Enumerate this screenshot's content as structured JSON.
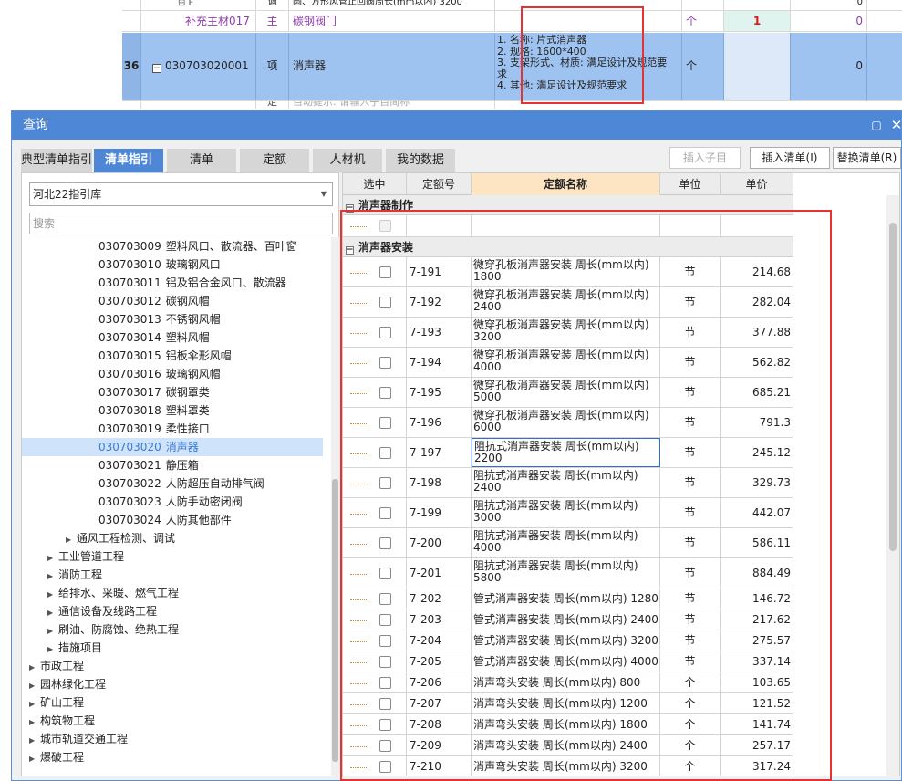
{
  "background": {
    "row_top": {
      "lines": [
        "圆、方形风管止回阀周长(mm以内) 3200"
      ],
      "kind": "调",
      "qty": "0"
    },
    "row_sub": {
      "name": "补充主材017",
      "kind": "主",
      "item": "碳钢阀门",
      "unit": "个",
      "qty": "1",
      "value": "0"
    },
    "row36": {
      "num": "36",
      "code": "030703020001",
      "kind": "项",
      "item": "消声器",
      "desc": [
        "1. 名称: 片式消声器",
        "2. 规格: 1600*400",
        "3. 支架形式、材质: 满足设计及规范要",
        "求",
        "4. 其他: 满足设计及规范要求"
      ],
      "unit": "个",
      "value": "0"
    },
    "row_next": {
      "kind": "定",
      "hint": "自动提示: 请输入子目简称"
    }
  },
  "dialog": {
    "title": "查询",
    "tabs": [
      "典型清单指引",
      "清单指引",
      "清单",
      "定额",
      "人材机",
      "我的数据"
    ],
    "buttons": {
      "insert_sub": "插入子目",
      "insert_list": "插入清单(I)",
      "replace_list": "替换清单(R)"
    },
    "library": "河北22指引库",
    "search_placeholder": "搜索",
    "tree": [
      {
        "code": "030703009",
        "label": "塑料风口、散流器、百叶窗"
      },
      {
        "code": "030703010",
        "label": "玻璃钢风口"
      },
      {
        "code": "030703011",
        "label": "铝及铝合金风口、散流器"
      },
      {
        "code": "030703012",
        "label": "碳钢风帽"
      },
      {
        "code": "030703013",
        "label": "不锈钢风帽"
      },
      {
        "code": "030703014",
        "label": "塑料风帽"
      },
      {
        "code": "030703015",
        "label": "铝板伞形风帽"
      },
      {
        "code": "030703016",
        "label": "玻璃钢风帽"
      },
      {
        "code": "030703017",
        "label": "碳钢罩类"
      },
      {
        "code": "030703018",
        "label": "塑料罩类"
      },
      {
        "code": "030703019",
        "label": "柔性接口"
      },
      {
        "code": "030703020",
        "label": "消声器"
      },
      {
        "code": "030703021",
        "label": "静压箱"
      },
      {
        "code": "030703022",
        "label": "人防超压自动排气阀"
      },
      {
        "code": "030703023",
        "label": "人防手动密闭阀"
      },
      {
        "code": "030703024",
        "label": "人防其他部件"
      }
    ],
    "tree_groups": [
      {
        "label": "通风工程检测、调试",
        "level": 3
      },
      {
        "label": "工业管道工程",
        "level": 2
      },
      {
        "label": "消防工程",
        "level": 2
      },
      {
        "label": "给排水、采暖、燃气工程",
        "level": 2
      },
      {
        "label": "通信设备及线路工程",
        "level": 2
      },
      {
        "label": "刷油、防腐蚀、绝热工程",
        "level": 2
      },
      {
        "label": "措施项目",
        "level": 2
      },
      {
        "label": "市政工程",
        "level": 1
      },
      {
        "label": "园林绿化工程",
        "level": 1
      },
      {
        "label": "矿山工程",
        "level": 1
      },
      {
        "label": "构筑物工程",
        "level": 1
      },
      {
        "label": "城市轨道交通工程",
        "level": 1
      },
      {
        "label": "爆破工程",
        "level": 1
      }
    ],
    "columns": [
      "选中",
      "定额号",
      "定额名称",
      "单位",
      "单价"
    ],
    "groups": [
      "消声器制作",
      "消声器安装"
    ],
    "rows": [
      {
        "code": "7-191",
        "name": [
          "微穿孔板消声器安装 周长(mm以内)",
          "1800"
        ],
        "unit": "节",
        "price": "214.68"
      },
      {
        "code": "7-192",
        "name": [
          "微穿孔板消声器安装 周长(mm以内)",
          "2400"
        ],
        "unit": "节",
        "price": "282.04"
      },
      {
        "code": "7-193",
        "name": [
          "微穿孔板消声器安装 周长(mm以内)",
          "3200"
        ],
        "unit": "节",
        "price": "377.88"
      },
      {
        "code": "7-194",
        "name": [
          "微穿孔板消声器安装 周长(mm以内)",
          "4000"
        ],
        "unit": "节",
        "price": "562.82"
      },
      {
        "code": "7-195",
        "name": [
          "微穿孔板消声器安装 周长(mm以内)",
          "5000"
        ],
        "unit": "节",
        "price": "685.21"
      },
      {
        "code": "7-196",
        "name": [
          "微穿孔板消声器安装 周长(mm以内)",
          "6000"
        ],
        "unit": "节",
        "price": "791.3"
      },
      {
        "code": "7-197",
        "name": [
          "阻抗式消声器安装 周长(mm以内)",
          "2200"
        ],
        "unit": "节",
        "price": "245.12"
      },
      {
        "code": "7-198",
        "name": [
          "阻抗式消声器安装 周长(mm以内)",
          "2400"
        ],
        "unit": "节",
        "price": "329.73"
      },
      {
        "code": "7-199",
        "name": [
          "阻抗式消声器安装 周长(mm以内)",
          "3000"
        ],
        "unit": "节",
        "price": "442.07"
      },
      {
        "code": "7-200",
        "name": [
          "阻抗式消声器安装 周长(mm以内)",
          "4000"
        ],
        "unit": "节",
        "price": "586.11"
      },
      {
        "code": "7-201",
        "name": [
          "阻抗式消声器安装 周长(mm以内)",
          "5800"
        ],
        "unit": "节",
        "price": "884.49"
      },
      {
        "code": "7-202",
        "name": [
          "管式消声器安装 周长(mm以内) 1280"
        ],
        "unit": "节",
        "price": "146.72"
      },
      {
        "code": "7-203",
        "name": [
          "管式消声器安装 周长(mm以内) 2400"
        ],
        "unit": "节",
        "price": "217.62"
      },
      {
        "code": "7-204",
        "name": [
          "管式消声器安装 周长(mm以内) 3200"
        ],
        "unit": "节",
        "price": "275.57"
      },
      {
        "code": "7-205",
        "name": [
          "管式消声器安装 周长(mm以内) 4000"
        ],
        "unit": "节",
        "price": "337.14"
      },
      {
        "code": "7-206",
        "name": [
          "消声弯头安装 周长(mm以内) 800"
        ],
        "unit": "个",
        "price": "103.65"
      },
      {
        "code": "7-207",
        "name": [
          "消声弯头安装 周长(mm以内) 1200"
        ],
        "unit": "个",
        "price": "121.52"
      },
      {
        "code": "7-208",
        "name": [
          "消声弯头安装 周长(mm以内) 1800"
        ],
        "unit": "个",
        "price": "141.74"
      },
      {
        "code": "7-209",
        "name": [
          "消声弯头安装 周长(mm以内) 2400"
        ],
        "unit": "个",
        "price": "257.17"
      },
      {
        "code": "7-210",
        "name": [
          "消声弯头安装 周长(mm以内) 3200"
        ],
        "unit": "个",
        "price": "317.24"
      }
    ]
  },
  "colors": {
    "accent": "#4d87d6",
    "selected_row": "#9fc3f0",
    "highlight": "#e53333",
    "purple": "#8e3fa8"
  }
}
